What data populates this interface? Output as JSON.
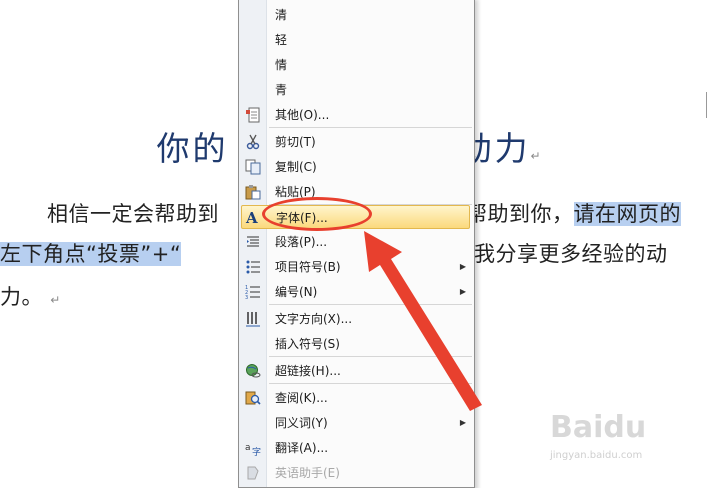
{
  "document": {
    "title_part1": "你的",
    "title_part2": "动力",
    "para_mark": "↵",
    "line1_a": "相信一定会帮助到",
    "line1_b": "帮助到你，",
    "line1_c": "请在网页的",
    "line2_a": "左下角点“投票”+“",
    "line2_b": "我分享更多经验的动",
    "line3": "力。"
  },
  "menu": {
    "items": [
      {
        "label": "清"
      },
      {
        "label": "轻"
      },
      {
        "label": "情"
      },
      {
        "label": "青"
      },
      {
        "label": "其他(O)..."
      },
      {
        "label": "剪切(T)"
      },
      {
        "label": "复制(C)"
      },
      {
        "label": "粘贴(P)"
      },
      {
        "label": "字体(F)..."
      },
      {
        "label": "段落(P)..."
      },
      {
        "label": "项目符号(B)"
      },
      {
        "label": "编号(N)"
      },
      {
        "label": "文字方向(X)..."
      },
      {
        "label": "插入符号(S)"
      },
      {
        "label": "超链接(H)..."
      },
      {
        "label": "查阅(K)..."
      },
      {
        "label": "同义词(Y)"
      },
      {
        "label": "翻译(A)..."
      },
      {
        "label": "英语助手(E)"
      }
    ],
    "submenu_glyph": "▶"
  },
  "icons": {
    "font_glyph": "A"
  },
  "watermark": {
    "logo": "Baidu",
    "url": "jingyan.baidu.com"
  },
  "colors": {
    "highlight": "#b7cff0",
    "annotation": "#e8402e",
    "menu_hover": "#fbd97d"
  }
}
